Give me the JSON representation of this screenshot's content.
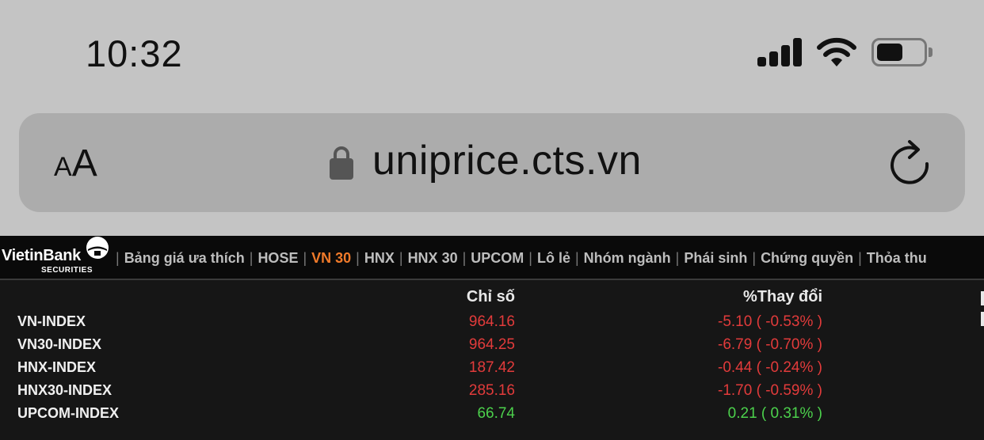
{
  "status": {
    "time": "10:32"
  },
  "browser": {
    "text_size_label_small": "A",
    "text_size_label_big": "A",
    "domain": "uniprice.cts.vn"
  },
  "brand": {
    "name": "VietinBank",
    "sub": "SECURITIES"
  },
  "nav": {
    "items": [
      "Bảng giá ưa thích",
      "HOSE",
      "VN 30",
      "HNX",
      "HNX 30",
      "UPCOM",
      "Lô lẻ",
      "Nhóm ngành",
      "Phái sinh",
      "Chứng quyền",
      "Thỏa thu"
    ],
    "active": "VN 30"
  },
  "market": {
    "headers": {
      "index": "Chỉ số",
      "change": "%Thay đổi"
    },
    "rows": [
      {
        "name": "VN-INDEX",
        "value": "964.16",
        "change": "-5.10 ( -0.53% )",
        "trend": "down"
      },
      {
        "name": "VN30-INDEX",
        "value": "964.25",
        "change": "-6.79 ( -0.70% )",
        "trend": "down"
      },
      {
        "name": "HNX-INDEX",
        "value": "187.42",
        "change": "-0.44 ( -0.24% )",
        "trend": "down"
      },
      {
        "name": "HNX30-INDEX",
        "value": "285.16",
        "change": "-1.70 ( -0.59% )",
        "trend": "down"
      },
      {
        "name": "UPCOM-INDEX",
        "value": "66.74",
        "change": "0.21 ( 0.31% )",
        "trend": "up"
      }
    ]
  },
  "colors": {
    "down": "#e23b3b",
    "up": "#4cd14c",
    "active_tab": "#f07a2a"
  }
}
